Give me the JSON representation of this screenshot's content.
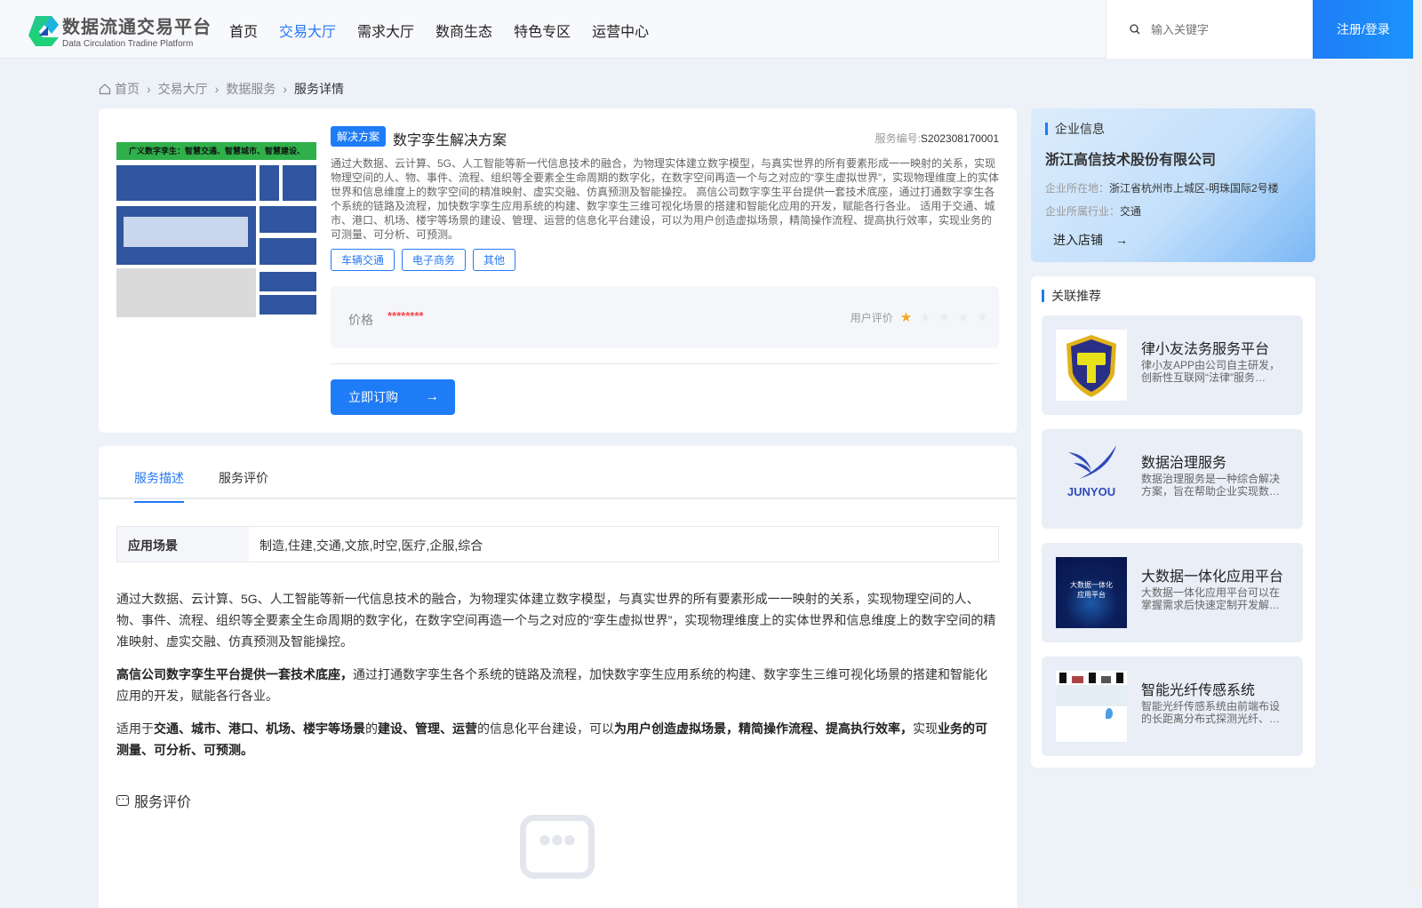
{
  "header": {
    "logo_title": "数据流通交易平台",
    "logo_sub": "Data Circulation Tradine Platform",
    "nav": [
      "首页",
      "交易大厅",
      "需求大厅",
      "数商生态",
      "特色专区",
      "运营中心"
    ],
    "active_nav": 1,
    "search_placeholder": "输入关键字",
    "login": "注册/登录"
  },
  "breadcrumb": [
    "首页",
    "交易大厅",
    "数据服务",
    "服务详情"
  ],
  "product": {
    "type_tag": "解决方案",
    "title": "数字孪生解决方案",
    "service_no_label": "服务编号:",
    "service_no": "S202308170001",
    "summary": "通过大数据、云计算、5G、人工智能等新一代信息技术的融合，为物理实体建立数字模型，与真实世界的所有要素形成一一映射的关系，实现物理空间的人、物、事件、流程、组织等全要素全生命周期的数字化，在数字空间再造一个与之对应的“孪生虚拟世界”，实现物理维度上的实体世界和信息维度上的数字空间的精准映射、虚实交融、仿真预测及智能操控。 高信公司数字孪生平台提供一套技术底座，通过打通数字孪生各个系统的链路及流程，加快数字孪生应用系统的构建、数字孪生三维可视化场景的搭建和智能化应用的开发，赋能各行各业。 适用于交通、城市、港口、机场、楼宇等场景的建设、管理、运营的信息化平台建设，可以为用户创造虚拟场景，精简操作流程、提高执行效率，实现业务的可测量、可分析、可预测。",
    "tags": [
      "车辆交通",
      "电子商务",
      "其他"
    ],
    "price_label": "价格",
    "price": "********",
    "rating_label": "用户评价",
    "rating": 1,
    "rating_max": 5,
    "buy": "立即订购",
    "image_banner": "广义数字孪生：智慧交通、智慧城市、智慧建设、"
  },
  "tabs": [
    "服务描述",
    "服务评价"
  ],
  "active_tab": 0,
  "scenario": {
    "label": "应用场景",
    "value": "制造,住建,交通,文旅,时空,医疗,企服,综合"
  },
  "description": [
    [
      {
        "t": "通过大数据、云计算、5G、人工智能等新一代信息技术的融合，为物理实体建立数字模型，与真实世界的所有要素形成一一映射的关系，实现物理空间的人、物、事件、流程、组织等全要素全生命周期的数字化，在数字空间再造一个与之对应的“孪生虚拟世界”，实现物理维度上的实体世界和信息维度上的数字空间的精准映射、虚实交融、仿真预测及智能操控。",
        "b": false
      }
    ],
    [
      {
        "t": "高信公司数字孪生平台提供一套技术底座，",
        "b": true
      },
      {
        "t": "通过打通数字孪生各个系统的链路及流程，加快数字孪生应用系统的构建、数字孪生三维可视化场景的搭建和智能化应用的开发，赋能各行各业。",
        "b": false
      }
    ],
    [
      {
        "t": "适用于",
        "b": false
      },
      {
        "t": "交通、城市、港口、机场、楼宇等场景",
        "b": true
      },
      {
        "t": "的",
        "b": false
      },
      {
        "t": "建设、管理、运营",
        "b": true
      },
      {
        "t": "的信息化平台建设，可以",
        "b": false
      },
      {
        "t": "为用户创造虚拟场景，精简操作流程、提高执行效率，",
        "b": true
      },
      {
        "t": "实现",
        "b": false
      },
      {
        "t": "业务的可测量、可分析、可预测。",
        "b": true
      }
    ]
  ],
  "review_title": "服务评价",
  "company": {
    "section": "企业信息",
    "name": "浙江高信技术股份有限公司",
    "loc_label": "企业所在地：",
    "loc": "浙江省杭州市上城区-明珠国际2号楼",
    "ind_label": "企业所属行业：",
    "ind": "交通",
    "enter": "进入店铺"
  },
  "related": {
    "section": "关联推荐",
    "items": [
      {
        "title": "律小友法务服务平台",
        "desc": "律小友APP由公司自主研发，创新性互联网“法律”服务…"
      },
      {
        "title": "数据治理服务",
        "desc": "数据治理服务是一种综合解决方案，旨在帮助企业实现数…",
        "logo_text": "JUNYOU"
      },
      {
        "title": "大数据一体化应用平台",
        "desc": "大数据一体化应用平台可以在掌握需求后快速定制开发解…",
        "img_text": "大数据一体化应用平台"
      },
      {
        "title": "智能光纤传感系统",
        "desc": "智能光纤传感系统由前端布设的长距离分布式探测光纤、…"
      }
    ]
  },
  "colors": {
    "accent": "#1e7cf7",
    "price": "#f04848",
    "star": "#f5a623"
  }
}
